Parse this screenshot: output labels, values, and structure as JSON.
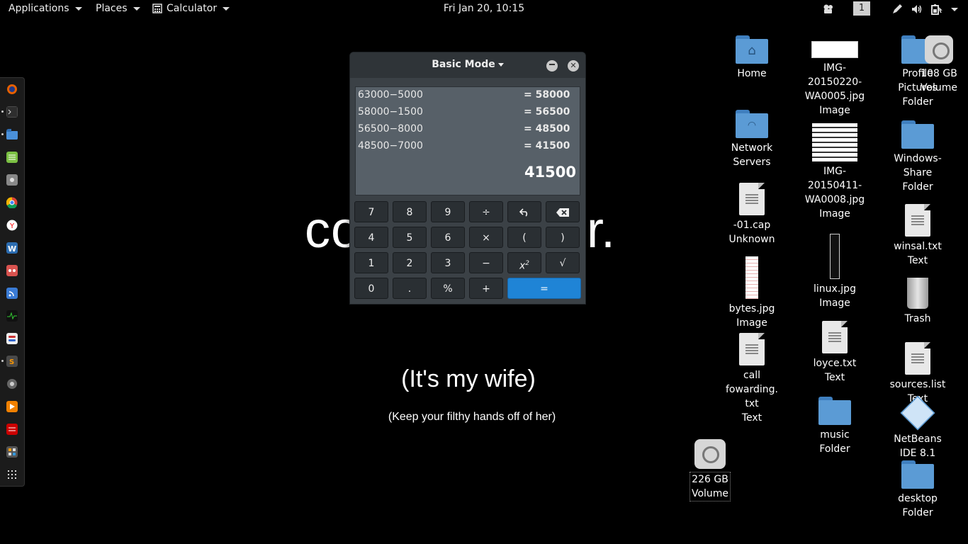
{
  "topbar": {
    "applications_label": "Applications",
    "places_label": "Places",
    "app_menu_label": "Calculator",
    "clock": "Fri Jan 20, 10:15",
    "workspace_number": "1"
  },
  "wallpaper": {
    "big_text_left": "co",
    "big_text_right": "r.",
    "subtitle": "(It's my wife)",
    "caption": "(Keep your filthy hands off of her)"
  },
  "calculator": {
    "mode_label": "Basic Mode",
    "history": [
      {
        "expr": "63000−5000",
        "result": "= 58000"
      },
      {
        "expr": "58000−1500",
        "result": "= 56500"
      },
      {
        "expr": "56500−8000",
        "result": "= 48500"
      },
      {
        "expr": "48500−7000",
        "result": "= 41500"
      }
    ],
    "display": "41500",
    "keys": {
      "k7": "7",
      "k8": "8",
      "k9": "9",
      "div": "÷",
      "undo": "↶",
      "backspace": "⌫",
      "k4": "4",
      "k5": "5",
      "k6": "6",
      "mul": "×",
      "lparen": "(",
      "rparen": ")",
      "k1": "1",
      "k2": "2",
      "k3": "3",
      "minus": "−",
      "square_base": "x",
      "square_exp": "2",
      "sqrt": "√",
      "k0": "0",
      "dot": ".",
      "percent": "%",
      "plus": "+",
      "equals": "="
    }
  },
  "desktop": {
    "home": {
      "name": "Home"
    },
    "network": {
      "name1": "Network",
      "name2": "Servers"
    },
    "cap": {
      "name": "-01.cap",
      "type": "Unknown"
    },
    "bytes": {
      "name": "bytes.jpg",
      "type": "Image"
    },
    "callfwd": {
      "name1": "call",
      "name2": "fowarding.",
      "name3": "txt",
      "type": "Text"
    },
    "vol226": {
      "name1": "226 GB",
      "name2": "Volume"
    },
    "img1": {
      "name1": "IMG-",
      "name2": "20150220-",
      "name3": "WA0005.jpg",
      "type": "Image"
    },
    "img2": {
      "name1": "IMG-",
      "name2": "20150411-",
      "name3": "WA0008.jpg",
      "type": "Image"
    },
    "linux": {
      "name": "linux.jpg",
      "type": "Image"
    },
    "loyce": {
      "name": "loyce.txt",
      "type": "Text"
    },
    "music": {
      "name": "music",
      "type": "Folder"
    },
    "profile": {
      "name1": "Profile",
      "name2": "Pictures",
      "type": "Folder"
    },
    "vol108": {
      "name1": "108 GB",
      "name2": "Volume"
    },
    "winshare": {
      "name1": "Windows-",
      "name2": "Share",
      "type": "Folder"
    },
    "winsal": {
      "name": "winsal.txt",
      "type": "Text"
    },
    "trash": {
      "name": "Trash"
    },
    "sources": {
      "name": "sources.list",
      "type": "Text"
    },
    "netbeans": {
      "name1": "NetBeans",
      "name2": "IDE 8.1"
    },
    "desktopf": {
      "name": "desktop",
      "type": "Folder"
    }
  },
  "dock_icons": [
    "firefox-icon",
    "terminal-icon",
    "files-icon",
    "spreadsheet-icon",
    "settings-icon",
    "chrome-icon",
    "yandex-icon",
    "writer-icon",
    "app-icon",
    "feed-icon",
    "monitor-icon",
    "toggle-icon",
    "sublime-icon",
    "gear-icon",
    "vlc-icon",
    "scanner-icon",
    "calculator-icon",
    "app-grid-icon"
  ]
}
